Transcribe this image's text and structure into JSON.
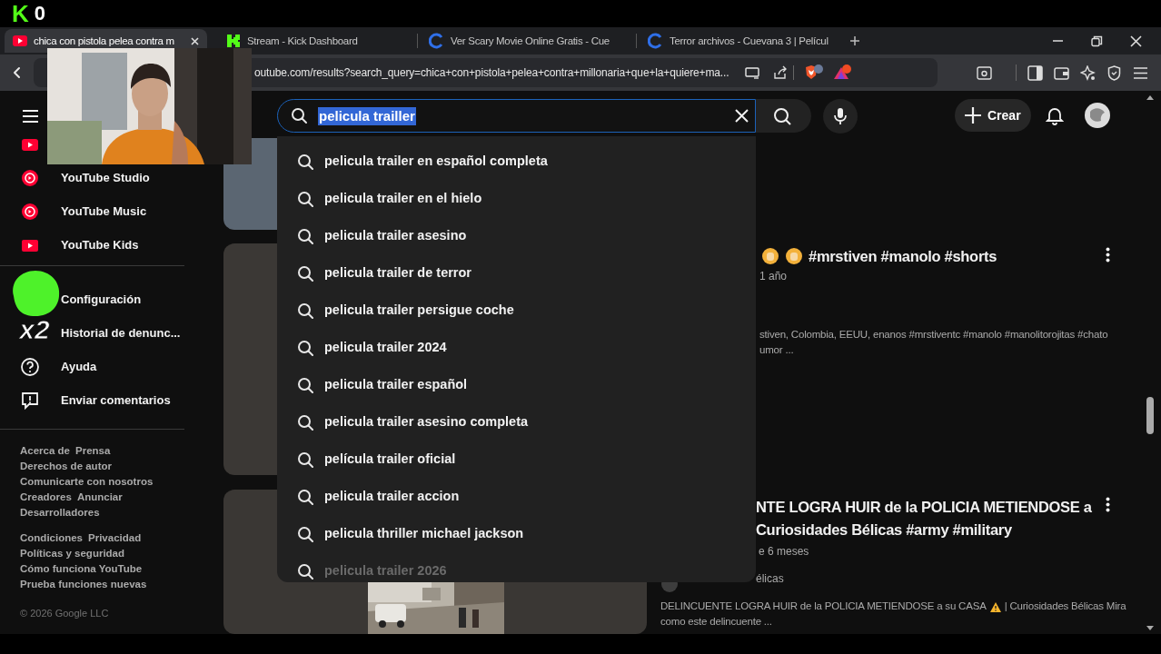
{
  "overlay": {
    "logo": "K",
    "viewer_count": "0",
    "sticker_text": "x2"
  },
  "tabs": [
    {
      "title": "chica con pistola pelea contra m",
      "kind": "youtube",
      "selected": true
    },
    {
      "title": "Stream - Kick Dashboard",
      "kind": "kick",
      "selected": false
    },
    {
      "title": "Ver Scary Movie Online Gratis - Cue",
      "kind": "cuevana",
      "selected": false
    },
    {
      "title": "Terror archivos - Cuevana 3 | Películ",
      "kind": "cuevana",
      "selected": false
    }
  ],
  "address_bar": {
    "url": "outube.com/results?search_query=chica+con+pistola+pelea+contra+millonaria+que+la+quiere+ma..."
  },
  "header": {
    "search": {
      "value": "pelicula trailler"
    },
    "create_button": "Crear"
  },
  "sidebar": {
    "sections": [
      [
        {
          "kind": "studio",
          "label": "YouTube Studio"
        },
        {
          "kind": "music",
          "label": "YouTube Music"
        },
        {
          "kind": "kids",
          "label": "YouTube Kids"
        }
      ],
      [
        {
          "label": "Configuración"
        },
        {
          "label": "Historial de denunc..."
        },
        {
          "kind": "help",
          "label": "Ayuda"
        },
        {
          "kind": "feedback",
          "label": "Enviar comentarios"
        }
      ]
    ],
    "footer_groups": [
      [
        [
          "Acerca de",
          "Prensa"
        ],
        [
          "Derechos de autor"
        ],
        [
          "Comunicarte con nosotros"
        ],
        [
          "Creadores",
          "Anunciar"
        ],
        [
          "Desarrolladores"
        ]
      ],
      [
        [
          "Condiciones",
          "Privacidad"
        ],
        [
          "Políticas y seguridad"
        ],
        [
          "Cómo funciona YouTube"
        ],
        [
          "Prueba funciones nuevas"
        ]
      ]
    ],
    "copyright": "© 2026 Google LLC"
  },
  "suggestions": [
    "pelicula trailer en español completa",
    "pelicula trailer en el hielo",
    "pelicula trailer asesino",
    "pelicula trailer de terror",
    "pelicula trailer persigue coche",
    "pelicula trailer 2024",
    "pelicula trailer español",
    "pelicula trailer asesino completa",
    "película trailer oficial",
    "pelicula trailer accion",
    "pelicula thriller michael jackson",
    "pelicula trailer 2026"
  ],
  "results": [
    {
      "title_lines": [
        [
          {
            "kind": "emoji"
          },
          {
            "kind": "emoji"
          },
          {
            "kind": "text",
            "text": "#mrstiven #manolo #shorts"
          }
        ]
      ],
      "meta": "1 año",
      "description_lines": [
        [
          {
            "kind": "text",
            "text": "stiven, Colombia, EEUU, enanos #mrstiventc #manolo #manolitorojitas #chato"
          }
        ],
        [
          {
            "kind": "text",
            "text": "umor ..."
          }
        ]
      ]
    },
    {
      "title_lines": [
        [
          {
            "kind": "text",
            "text": "NTE LOGRA HUIR de la POLICIA METIENDOSE a"
          }
        ],
        [
          {
            "kind": "text",
            "text": "Curiosidades Bélicas #army #military"
          }
        ]
      ],
      "meta": "e 6 meses",
      "channel": "élicas",
      "description_lines": [
        [
          {
            "kind": "text",
            "text": "DELINCUENTE LOGRA HUIR de la POLICIA METIENDOSE a su CASA"
          },
          {
            "kind": "warning"
          },
          {
            "kind": "text",
            "text": "| Curiosidades Bélicas Mira"
          }
        ],
        [
          {
            "kind": "text",
            "text": "como este delincuente ..."
          }
        ]
      ]
    }
  ]
}
